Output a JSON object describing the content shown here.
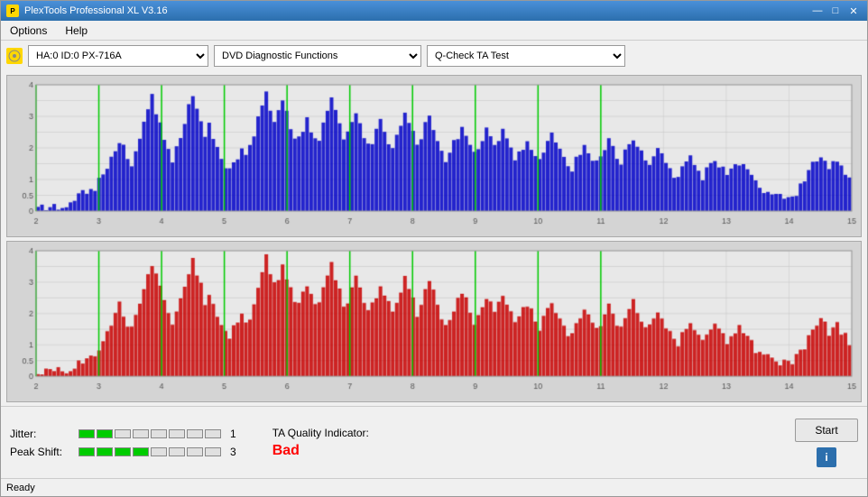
{
  "titleBar": {
    "title": "PlexTools Professional XL V3.16",
    "iconLabel": "P",
    "minimize": "—",
    "maximize": "□",
    "close": "✕"
  },
  "menu": {
    "items": [
      "Options",
      "Help"
    ]
  },
  "toolbar": {
    "driveIcon": "●",
    "driveValue": "HA:0 ID:0  PX-716A",
    "functionValue": "DVD Diagnostic Functions",
    "testValue": "Q-Check TA Test"
  },
  "charts": {
    "top": {
      "yMax": 4,
      "xMin": 2,
      "xMax": 15,
      "color": "#0000ff"
    },
    "bottom": {
      "yMax": 4,
      "xMin": 2,
      "xMax": 15,
      "color": "#cc0000"
    }
  },
  "bottomPanel": {
    "jitterLabel": "Jitter:",
    "jitterFilledBars": 2,
    "jitterTotalBars": 8,
    "jitterValue": "1",
    "peakShiftLabel": "Peak Shift:",
    "peakShiftFilledBars": 4,
    "peakShiftTotalBars": 8,
    "peakShiftValue": "3",
    "taLabel": "TA Quality Indicator:",
    "taValue": "Bad",
    "startButton": "Start",
    "infoButton": "i"
  },
  "statusBar": {
    "text": "Ready"
  }
}
